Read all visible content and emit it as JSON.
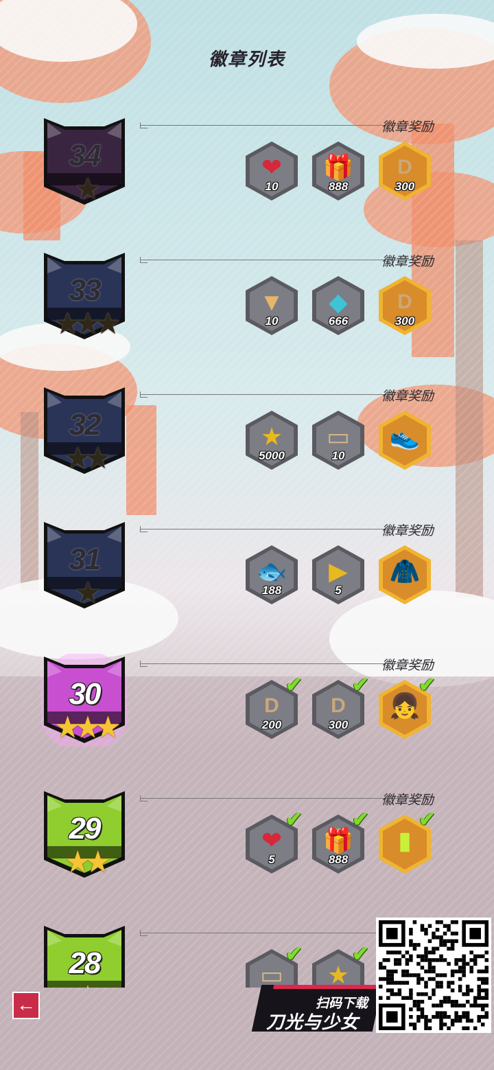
{
  "title": "徽章列表",
  "reward_label": "徽章奖励",
  "badges": [
    {
      "level": "34",
      "stars": "★",
      "style": "dark",
      "theme": "#3a2540",
      "items": [
        {
          "icon": "heart-upgrade-icon",
          "glyph": "❤",
          "qty": "10",
          "color": "#d6283a",
          "claimed": false,
          "frame": "gray"
        },
        {
          "icon": "gift-box-icon",
          "glyph": "🎁",
          "qty": "888",
          "color": "#e24a4a",
          "claimed": false,
          "frame": "gray"
        },
        {
          "icon": "coupon-d-icon",
          "glyph": "D",
          "qty": "300",
          "color": "#caa77d",
          "claimed": false,
          "frame": "gold"
        }
      ]
    },
    {
      "level": "33",
      "stars": "★★★",
      "style": "dark",
      "theme": "#2a3457",
      "items": [
        {
          "icon": "scroll-upgrade-icon",
          "glyph": "▼",
          "qty": "10",
          "color": "#e6b66c",
          "claimed": false,
          "frame": "gray"
        },
        {
          "icon": "crystal-icon",
          "glyph": "◆",
          "qty": "666",
          "color": "#3ec4d6",
          "claimed": false,
          "frame": "gray"
        },
        {
          "icon": "coupon-d-icon",
          "glyph": "D",
          "qty": "300",
          "color": "#caa77d",
          "claimed": false,
          "frame": "gold"
        }
      ]
    },
    {
      "level": "32",
      "stars": "★★",
      "style": "dark",
      "theme": "#2a3457",
      "items": [
        {
          "icon": "star-coin-icon",
          "glyph": "★",
          "qty": "5000",
          "color": "#e8b820",
          "claimed": false,
          "frame": "gray"
        },
        {
          "icon": "ticket-icon",
          "glyph": "▭",
          "qty": "10",
          "color": "#d3b789",
          "claimed": false,
          "frame": "gray"
        },
        {
          "icon": "sneakers-icon",
          "glyph": "👟",
          "qty": "",
          "color": "#e63b44",
          "claimed": false,
          "frame": "gold"
        }
      ]
    },
    {
      "level": "31",
      "stars": "★",
      "style": "dark",
      "theme": "#2a3457",
      "items": [
        {
          "icon": "fish-icon",
          "glyph": "🐟",
          "qty": "188",
          "color": "#58b6e6",
          "claimed": false,
          "frame": "gray"
        },
        {
          "icon": "video-box-icon",
          "glyph": "▶",
          "qty": "5",
          "color": "#e8b820",
          "claimed": false,
          "frame": "gray"
        },
        {
          "icon": "jacket-icon",
          "glyph": "🧥",
          "qty": "",
          "color": "#c8233b",
          "claimed": false,
          "frame": "gold"
        }
      ]
    },
    {
      "level": "30",
      "stars": "★★★",
      "style": "pink",
      "theme": "#c84fd0",
      "items": [
        {
          "icon": "coupon-d-icon",
          "glyph": "D",
          "qty": "200",
          "color": "#caa77d",
          "claimed": true,
          "frame": "gray"
        },
        {
          "icon": "coupon-d-icon",
          "glyph": "D",
          "qty": "300",
          "color": "#caa77d",
          "claimed": true,
          "frame": "gray"
        },
        {
          "icon": "hairstyle-icon",
          "glyph": "👧",
          "qty": "",
          "color": "#e34f5c",
          "claimed": true,
          "frame": "gold"
        }
      ]
    },
    {
      "level": "29",
      "stars": "★★",
      "style": "green",
      "theme": "#8fce2e",
      "items": [
        {
          "icon": "heart-upgrade-icon",
          "glyph": "❤",
          "qty": "5",
          "color": "#d6283a",
          "claimed": true,
          "frame": "gray"
        },
        {
          "icon": "gift-box-icon",
          "glyph": "🎁",
          "qty": "888",
          "color": "#e24a4a",
          "claimed": true,
          "frame": "gray"
        },
        {
          "icon": "shorts-icon",
          "glyph": "▮",
          "qty": "",
          "color": "#c8f23a",
          "claimed": true,
          "frame": "gold"
        }
      ]
    },
    {
      "level": "28",
      "stars": "★",
      "style": "green",
      "theme": "#8fce2e",
      "items": [
        {
          "icon": "ticket-icon",
          "glyph": "▭",
          "qty": "",
          "color": "#d3b789",
          "claimed": true,
          "frame": "gray"
        },
        {
          "icon": "star-coin-icon",
          "glyph": "★",
          "qty": "",
          "color": "#e8b820",
          "claimed": true,
          "frame": "gray"
        }
      ]
    }
  ],
  "promo": {
    "line1": "扫码下载",
    "line2": "刀光与少女"
  },
  "back_icon": "back-arrow-icon"
}
